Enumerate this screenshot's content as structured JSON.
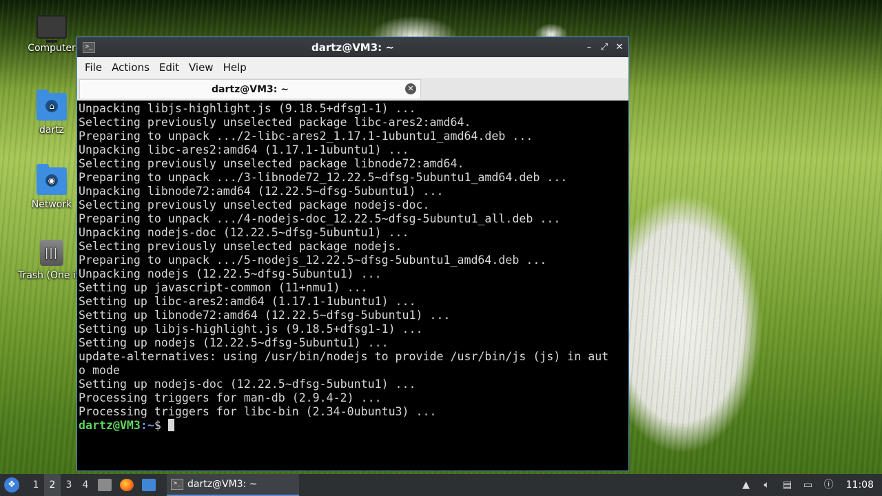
{
  "desktop": {
    "icons": [
      {
        "label": "Computer",
        "icon": "computer-icon"
      },
      {
        "label": "dartz",
        "icon": "home-folder-icon"
      },
      {
        "label": "Network",
        "icon": "network-folder-icon"
      },
      {
        "label": "Trash (One ite",
        "icon": "trash-icon"
      }
    ]
  },
  "window": {
    "title": "dartz@VM3: ~",
    "menu": [
      "File",
      "Actions",
      "Edit",
      "View",
      "Help"
    ],
    "tab_label": "dartz@VM3: ~"
  },
  "terminal": {
    "lines": [
      "Unpacking libjs-highlight.js (9.18.5+dfsg1-1) ...",
      "Selecting previously unselected package libc-ares2:amd64.",
      "Preparing to unpack .../2-libc-ares2_1.17.1-1ubuntu1_amd64.deb ...",
      "Unpacking libc-ares2:amd64 (1.17.1-1ubuntu1) ...",
      "Selecting previously unselected package libnode72:amd64.",
      "Preparing to unpack .../3-libnode72_12.22.5~dfsg-5ubuntu1_amd64.deb ...",
      "Unpacking libnode72:amd64 (12.22.5~dfsg-5ubuntu1) ...",
      "Selecting previously unselected package nodejs-doc.",
      "Preparing to unpack .../4-nodejs-doc_12.22.5~dfsg-5ubuntu1_all.deb ...",
      "Unpacking nodejs-doc (12.22.5~dfsg-5ubuntu1) ...",
      "Selecting previously unselected package nodejs.",
      "Preparing to unpack .../5-nodejs_12.22.5~dfsg-5ubuntu1_amd64.deb ...",
      "Unpacking nodejs (12.22.5~dfsg-5ubuntu1) ...",
      "Setting up javascript-common (11+nmu1) ...",
      "Setting up libc-ares2:amd64 (1.17.1-1ubuntu1) ...",
      "Setting up libnode72:amd64 (12.22.5~dfsg-5ubuntu1) ...",
      "Setting up libjs-highlight.js (9.18.5+dfsg1-1) ...",
      "Setting up nodejs (12.22.5~dfsg-5ubuntu1) ...",
      "update-alternatives: using /usr/bin/nodejs to provide /usr/bin/js (js) in aut",
      "o mode",
      "Setting up nodejs-doc (12.22.5~dfsg-5ubuntu1) ...",
      "Processing triggers for man-db (2.9.4-2) ...",
      "Processing triggers for libc-bin (2.34-0ubuntu3) ..."
    ],
    "prompt": {
      "user_host": "dartz@VM3",
      "sep": ":",
      "path": "~",
      "symbol": "$ "
    }
  },
  "taskbar": {
    "workspaces": [
      "1",
      "2",
      "3",
      "4"
    ],
    "active_workspace": "2",
    "launchers": [
      "files-icon",
      "firefox-icon",
      "show-desktop-icon"
    ],
    "task_label": "dartz@VM3: ~",
    "tray": [
      "up-arrow-icon",
      "volume-icon",
      "clipboard-icon",
      "display-icon",
      "update-notifier-icon"
    ],
    "clock": "11:08"
  },
  "colors": {
    "prompt_user": "#5fd35f",
    "prompt_path": "#6c8fe0",
    "window_border": "#4a8fd8",
    "taskbar_bg": "#2d3033"
  }
}
